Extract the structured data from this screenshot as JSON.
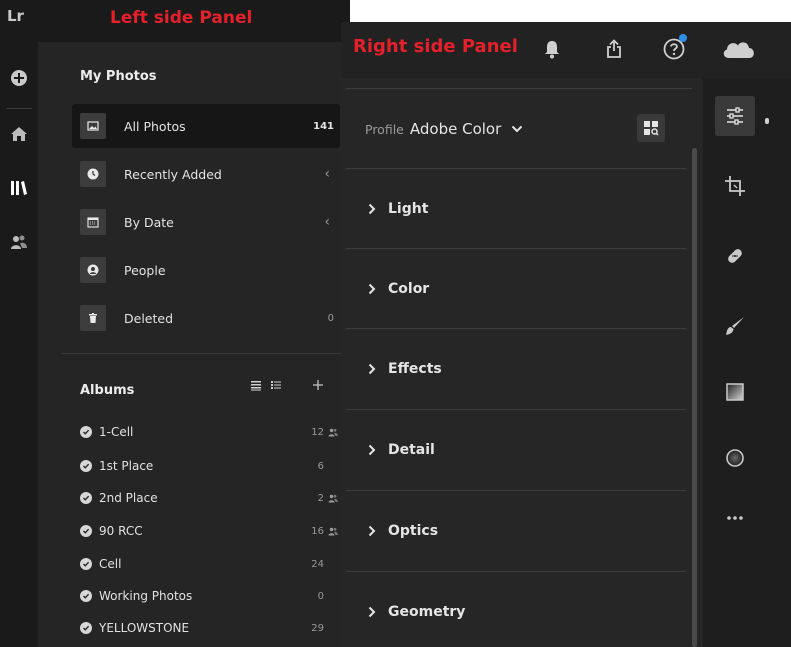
{
  "app": {
    "logo": "Lr"
  },
  "annotations": {
    "left_panel": "Left side Panel",
    "right_panel": "Right side Panel"
  },
  "rail": {
    "items": [
      {
        "icon": "add-icon"
      },
      {
        "icon": "home-icon"
      },
      {
        "icon": "library-icon",
        "active": true
      },
      {
        "icon": "people-icon"
      }
    ]
  },
  "my_photos": {
    "title": "My Photos",
    "items": [
      {
        "label": "All Photos",
        "count": "141",
        "icon": "photo-icon",
        "active": true
      },
      {
        "label": "Recently Added",
        "count": "",
        "icon": "clock-icon",
        "expandable": true
      },
      {
        "label": "By Date",
        "count": "",
        "icon": "calendar-icon",
        "expandable": true
      },
      {
        "label": "People",
        "count": "",
        "icon": "person-icon"
      },
      {
        "label": "Deleted",
        "count": "0",
        "icon": "trash-icon"
      }
    ]
  },
  "albums": {
    "title": "Albums",
    "items": [
      {
        "name": "1-Cell",
        "count": "12",
        "shared": true
      },
      {
        "name": "1st Place",
        "count": "6",
        "shared": false
      },
      {
        "name": "2nd Place",
        "count": "2",
        "shared": true
      },
      {
        "name": "90 RCC",
        "count": "16",
        "shared": true
      },
      {
        "name": "Cell",
        "count": "24",
        "shared": false
      },
      {
        "name": "Working Photos",
        "count": "0",
        "shared": false
      },
      {
        "name": "YELLOWSTONE",
        "count": "29",
        "shared": false
      }
    ]
  },
  "header_icons": [
    "bell-icon",
    "share-icon",
    "help-icon",
    "cloud-icon"
  ],
  "edit": {
    "profile_label": "Profile",
    "profile_value": "Adobe Color",
    "sections": [
      "Light",
      "Color",
      "Effects",
      "Detail",
      "Optics",
      "Geometry"
    ]
  },
  "tools": [
    "edit-sliders-icon",
    "crop-icon",
    "healing-icon",
    "brush-icon",
    "linear-gradient-icon",
    "radial-gradient-icon",
    "more-icon"
  ],
  "colors": {
    "annotation_red": "#e5202b",
    "notification_blue": "#2f8fe8",
    "panel_bg": "#252525"
  }
}
